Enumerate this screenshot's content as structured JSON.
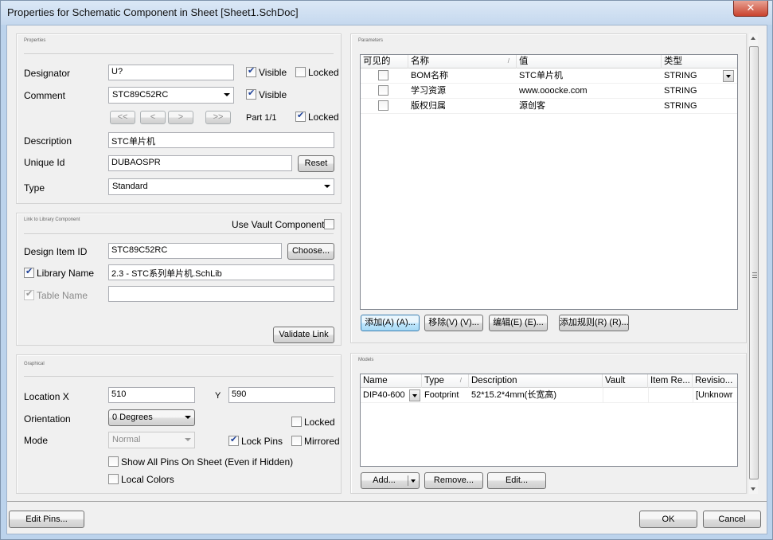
{
  "window": {
    "title": "Properties for Schematic Component in Sheet [Sheet1.SchDoc]",
    "close_glyph": "✕"
  },
  "properties": {
    "section_title": "Properties",
    "designator_label": "Designator",
    "designator_value": "U?",
    "designator_visible_label": "Visible",
    "designator_visible": true,
    "designator_locked_label": "Locked",
    "designator_locked": false,
    "comment_label": "Comment",
    "comment_value": "STC89C52RC",
    "comment_visible_label": "Visible",
    "comment_visible": true,
    "nav_first": "<<",
    "nav_prev": "<",
    "nav_next": ">",
    "nav_last": ">>",
    "part_label": "Part 1/1",
    "part_locked_label": "Locked",
    "part_locked": true,
    "description_label": "Description",
    "description_value": "STC单片机",
    "unique_id_label": "Unique Id",
    "unique_id_value": "DUBAOSPR",
    "reset_button": "Reset",
    "type_label": "Type",
    "type_value": "Standard"
  },
  "library_link": {
    "section_title": "Link to Library Component",
    "use_vault_label": "Use Vault Component",
    "use_vault": false,
    "design_item_id_label": "Design Item ID",
    "design_item_id_value": "STC89C52RC",
    "choose_button": "Choose...",
    "library_name_label": "Library Name",
    "library_name_checked": true,
    "library_name_value": "2.3   - STC系列单片机.SchLib",
    "table_name_label": "Table Name",
    "table_name_checked": true,
    "table_name_value": "",
    "validate_button": "Validate Link"
  },
  "graphical": {
    "section_title": "Graphical",
    "location_label": "Location  X",
    "location_x": "510",
    "y_label": "Y",
    "location_y": "590",
    "orientation_label": "Orientation",
    "orientation_value": "0 Degrees",
    "locked_label": "Locked",
    "locked": false,
    "mode_label": "Mode",
    "mode_value": "Normal",
    "lock_pins_label": "Lock Pins",
    "lock_pins": true,
    "mirrored_label": "Mirrored",
    "mirrored": false,
    "show_all_pins_label": "Show All Pins On Sheet (Even if Hidden)",
    "show_all_pins": false,
    "local_colors_label": "Local Colors",
    "local_colors": false
  },
  "parameters": {
    "section_title": "Parameters",
    "columns": [
      "可见的",
      "名称",
      "值",
      "类型"
    ],
    "rows": [
      {
        "visible": false,
        "name": "BOM名称",
        "value": "STC单片机",
        "type": "STRING"
      },
      {
        "visible": false,
        "name": "学习资源",
        "value": "www.ooocke.com",
        "type": "STRING"
      },
      {
        "visible": false,
        "name": "版权归属",
        "value": "源创客",
        "type": "STRING"
      }
    ],
    "sort_glyph": "/",
    "add_button": "添加(A) (A)...",
    "remove_button": "移除(V) (V)...",
    "edit_button": "编辑(E) (E)...",
    "add_rule_button": "添加规则(R) (R)..."
  },
  "models": {
    "section_title": "Models",
    "columns": [
      "Name",
      "Type",
      "Description",
      "Vault",
      "Item Re...",
      "Revisio..."
    ],
    "rows": [
      {
        "name": "DIP40-600",
        "type": "Footprint",
        "description": "52*15.2*4mm(长宽高)",
        "vault": "",
        "item_rev": "",
        "revision": "[Unknowr"
      }
    ],
    "sort_glyph": "/",
    "add_button": "Add...",
    "remove_button": "Remove...",
    "edit_button": "Edit..."
  },
  "footer": {
    "edit_pins_button": "Edit Pins...",
    "ok_button": "OK",
    "cancel_button": "Cancel"
  }
}
